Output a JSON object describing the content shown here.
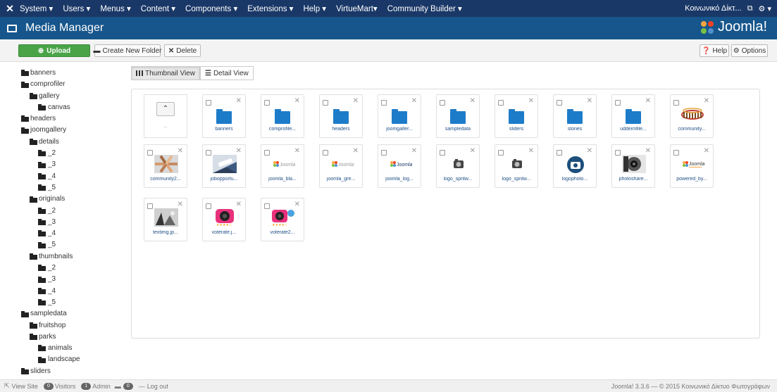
{
  "topnav": {
    "menus": [
      "System ▾",
      "Users ▾",
      "Menus ▾",
      "Content ▾",
      "Components ▾",
      "Extensions ▾",
      "Help ▾",
      "VirtueMart▾",
      "Community Builder ▾"
    ],
    "site_label": "Κοινωνικό Δίκτ...",
    "external_icon": "external-link-icon",
    "gear_icon": "gear-icon"
  },
  "header": {
    "title": "Media Manager",
    "logo_text": "Joomla!"
  },
  "toolbar": {
    "upload_label": "Upload",
    "create_folder_label": "Create New Folder",
    "delete_label": "Delete",
    "help_label": "Help",
    "options_label": "Options"
  },
  "tree": [
    {
      "label": "banners",
      "level": 0
    },
    {
      "label": "comprofiler",
      "level": 0
    },
    {
      "label": "gallery",
      "level": 1
    },
    {
      "label": "canvas",
      "level": 2
    },
    {
      "label": "headers",
      "level": 0
    },
    {
      "label": "joomgallery",
      "level": 0
    },
    {
      "label": "details",
      "level": 1
    },
    {
      "label": "_2",
      "level": 2
    },
    {
      "label": "_3",
      "level": 2
    },
    {
      "label": "_4",
      "level": 2
    },
    {
      "label": "_5",
      "level": 2
    },
    {
      "label": "originals",
      "level": 1
    },
    {
      "label": "_2",
      "level": 2
    },
    {
      "label": "_3",
      "level": 2
    },
    {
      "label": "_4",
      "level": 2
    },
    {
      "label": "_5",
      "level": 2
    },
    {
      "label": "thumbnails",
      "level": 1
    },
    {
      "label": "_2",
      "level": 2
    },
    {
      "label": "_3",
      "level": 2
    },
    {
      "label": "_4",
      "level": 2
    },
    {
      "label": "_5",
      "level": 2
    },
    {
      "label": "sampledata",
      "level": 0
    },
    {
      "label": "fruitshop",
      "level": 1
    },
    {
      "label": "parks",
      "level": 1
    },
    {
      "label": "animals",
      "level": 2
    },
    {
      "label": "landscape",
      "level": 2
    },
    {
      "label": "sliders",
      "level": 0
    }
  ],
  "views": {
    "thumbnail_label": "Thumbnail View",
    "detail_label": "Detail View"
  },
  "up_tile": {
    "dots": ".."
  },
  "items": [
    {
      "caption": "banners",
      "kind": "folder"
    },
    {
      "caption": "comprofile...",
      "kind": "folder"
    },
    {
      "caption": "headers",
      "kind": "folder"
    },
    {
      "caption": "joomgaller...",
      "kind": "folder"
    },
    {
      "caption": "sampledata",
      "kind": "folder"
    },
    {
      "caption": "sliders",
      "kind": "folder"
    },
    {
      "caption": "stories",
      "kind": "folder"
    },
    {
      "caption": "uddeimfile...",
      "kind": "folder"
    },
    {
      "caption": "community...",
      "kind": "image",
      "thumb": "people-banner"
    },
    {
      "caption": "community2...",
      "kind": "image",
      "thumb": "hands-circle"
    },
    {
      "caption": "jobopportu...",
      "kind": "image",
      "thumb": "job-keyboard"
    },
    {
      "caption": "joomla_bla...",
      "kind": "image",
      "thumb": "joomla-logo"
    },
    {
      "caption": "joomla_gre...",
      "kind": "image",
      "thumb": "joomla-logo"
    },
    {
      "caption": "joomla_log...",
      "kind": "image",
      "thumb": "joomla-logo-dark"
    },
    {
      "caption": "logo_spntw...",
      "kind": "image",
      "thumb": "camera-small"
    },
    {
      "caption": "logo_spntw...",
      "kind": "image",
      "thumb": "camera-small"
    },
    {
      "caption": "logophoto...",
      "kind": "image",
      "thumb": "camera-round"
    },
    {
      "caption": "photoshare...",
      "kind": "image",
      "thumb": "photographer"
    },
    {
      "caption": "powered_by...",
      "kind": "image",
      "thumb": "joomla-powered"
    },
    {
      "caption": "textimg.jp...",
      "kind": "image",
      "thumb": "bw-photo"
    },
    {
      "caption": "voterate.j...",
      "kind": "image",
      "thumb": "voterate"
    },
    {
      "caption": "voterate2...",
      "kind": "image",
      "thumb": "voterate2"
    }
  ],
  "joomla_logo_text": "Joomla!",
  "statusbar": {
    "view_site": "View Site",
    "visitors_count": "0",
    "visitors_label": "Visitors",
    "admin_count": "1",
    "admin_label": "Admin",
    "messages_count": "0",
    "logout": "Log out",
    "version": "Joomla! 3.3.6 — © 2015 Κοινωνικό Δίκτυο Φωτογράφων"
  },
  "colors": {
    "topnav": "#1a3867",
    "header": "#17568c",
    "upload": "#4aa447",
    "folder": "#1d7cc9"
  }
}
